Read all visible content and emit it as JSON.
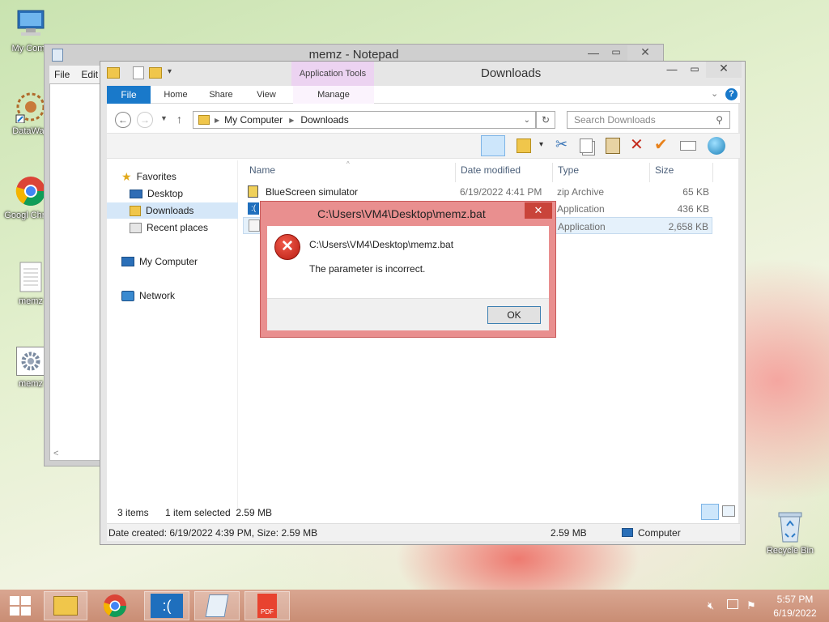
{
  "desktop": {
    "icons": [
      {
        "label": "My Comp",
        "icon": "computer-icon"
      },
      {
        "label": "DataWag",
        "icon": "datawag-icon"
      },
      {
        "label": "Googl Chrom",
        "icon": "chrome-icon"
      },
      {
        "label": "memz",
        "icon": "text-file-icon"
      },
      {
        "label": "memz",
        "icon": "gear-file-icon"
      }
    ],
    "recycle_bin": "Recycle Bin"
  },
  "notepad": {
    "title": "memz - Notepad",
    "menu": [
      "File",
      "Edit"
    ],
    "scroll_left": "<"
  },
  "explorer": {
    "title": "Downloads",
    "contextual_tab": "Application Tools",
    "ribbon_tabs": {
      "file": "File",
      "home": "Home",
      "share": "Share",
      "view": "View",
      "manage": "Manage"
    },
    "breadcrumb": [
      "My Computer",
      "Downloads"
    ],
    "search_placeholder": "Search Downloads",
    "nav": {
      "favorites": "Favorites",
      "desktop": "Desktop",
      "downloads": "Downloads",
      "recent": "Recent places",
      "computer": "My Computer",
      "network": "Network"
    },
    "columns": {
      "name": "Name",
      "date": "Date modified",
      "type": "Type",
      "size": "Size"
    },
    "files": [
      {
        "name": "BlueScreen simulator",
        "date": "6/19/2022 4:41 PM",
        "type": "zip Archive",
        "size": "65 KB"
      },
      {
        "name": "",
        "date": "",
        "type": "Application",
        "size": "436 KB"
      },
      {
        "name": "",
        "date": "",
        "type": "Application",
        "size": "2,658 KB"
      }
    ],
    "status": {
      "items": "3 items",
      "selected": "1 item selected  2.59 MB"
    },
    "details": {
      "created": "Date created: 6/19/2022 4:39 PM, Size: 2.59 MB",
      "size": "2.59 MB",
      "location": "Computer"
    }
  },
  "dialog": {
    "title": "C:\\Users\\VM4\\Desktop\\memz.bat",
    "path": "C:\\Users\\VM4\\Desktop\\memz.bat",
    "message": "The parameter is incorrect.",
    "ok": "OK"
  },
  "taskbar": {
    "time": "5:57 PM",
    "date": "6/19/2022",
    "pdf_label": "PDF"
  },
  "colors": {
    "accent": "#1979ca",
    "error": "#c42b1c",
    "dialog_frame": "#e98f8f",
    "taskbar": "#cf957c"
  }
}
